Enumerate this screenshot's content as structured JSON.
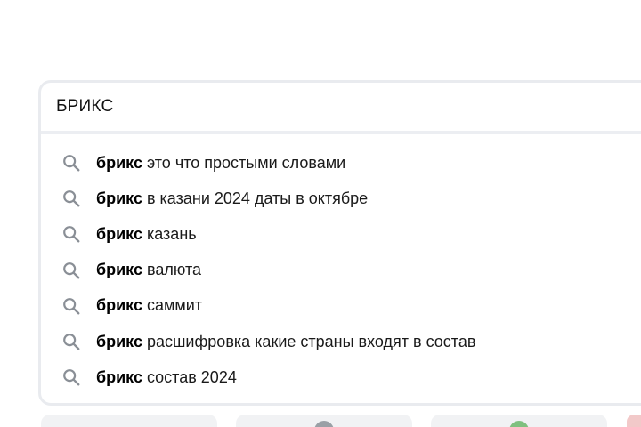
{
  "search": {
    "value": "БРИКС"
  },
  "suggestions": [
    {
      "bold": "брикс",
      "rest": " это что простыми словами",
      "icon": "search-icon"
    },
    {
      "bold": "брикс",
      "rest": " в казани 2024 даты в октябре",
      "icon": "search-icon"
    },
    {
      "bold": "брикс",
      "rest": " казань",
      "icon": "search-icon"
    },
    {
      "bold": "брикс",
      "rest": " валюта",
      "icon": "search-icon"
    },
    {
      "bold": "брикс",
      "rest": " саммит",
      "icon": "search-icon"
    },
    {
      "bold": "брикс",
      "rest": " расшифровка какие страны входят в состав",
      "icon": "search-icon"
    },
    {
      "bold": "брикс",
      "rest": " состав 2024",
      "icon": "search-icon"
    }
  ],
  "colors": {
    "border": "#e9ebef",
    "icon": "#8a8f96",
    "card": "#f1f2f4",
    "card_accent_gray": "#9aa0a6",
    "card_accent_green": "#7fc07f",
    "card_accent_red": "#f2c9c9"
  }
}
